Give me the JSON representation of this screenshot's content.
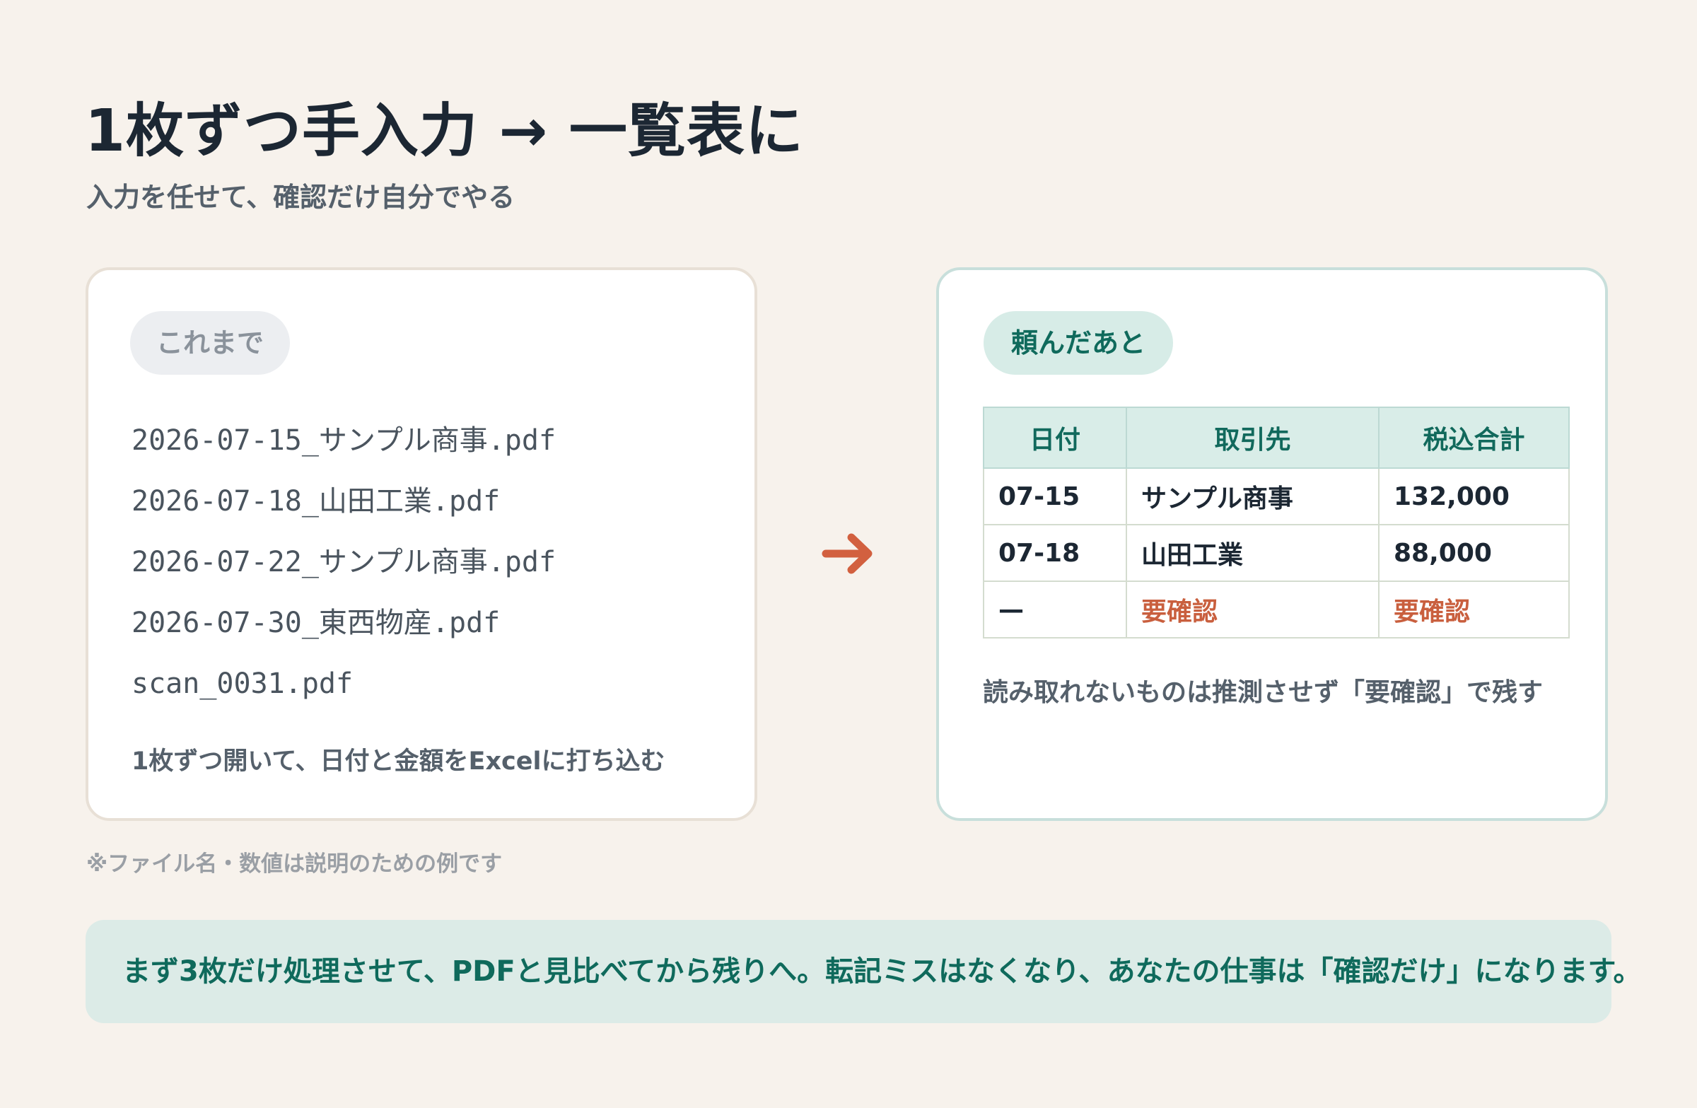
{
  "header": {
    "title": "1枚ずつ手入力 → 一覧表に",
    "subtitle": "入力を任せて、確認だけ自分でやる"
  },
  "before": {
    "badge": "これまで",
    "files": [
      "2026-07-15_サンプル商事.pdf",
      "2026-07-18_山田工業.pdf",
      "2026-07-22_サンプル商事.pdf",
      "2026-07-30_東西物産.pdf",
      "scan_0031.pdf"
    ],
    "note": "1枚ずつ開いて、日付と金額をExcelに打ち込む"
  },
  "arrow_icon": "arrow-right-icon",
  "after": {
    "badge": "頼んだあと",
    "table": {
      "headers": [
        "日付",
        "取引先",
        "税込合計"
      ],
      "rows": [
        [
          "07-15",
          "サンプル商事",
          "132,000"
        ],
        [
          "07-18",
          "山田工業",
          "88,000"
        ],
        [
          "—",
          "要確認",
          "要確認"
        ]
      ]
    },
    "note": "読み取れないものは推測させず「要確認」で残す"
  },
  "footnote": "※ファイル名・数値は説明のための例です",
  "banner": {
    "text": "まず3枚だけ処理させて、PDFと見比べてから残りへ。転記ミスはなくなり、あなたの仕事は「確認だけ」になります。"
  },
  "colors": {
    "background": "#f7f2ec",
    "accent_green": "#0f6a5c",
    "warning_orange": "#c95f3e",
    "arrow": "#d2603f"
  }
}
